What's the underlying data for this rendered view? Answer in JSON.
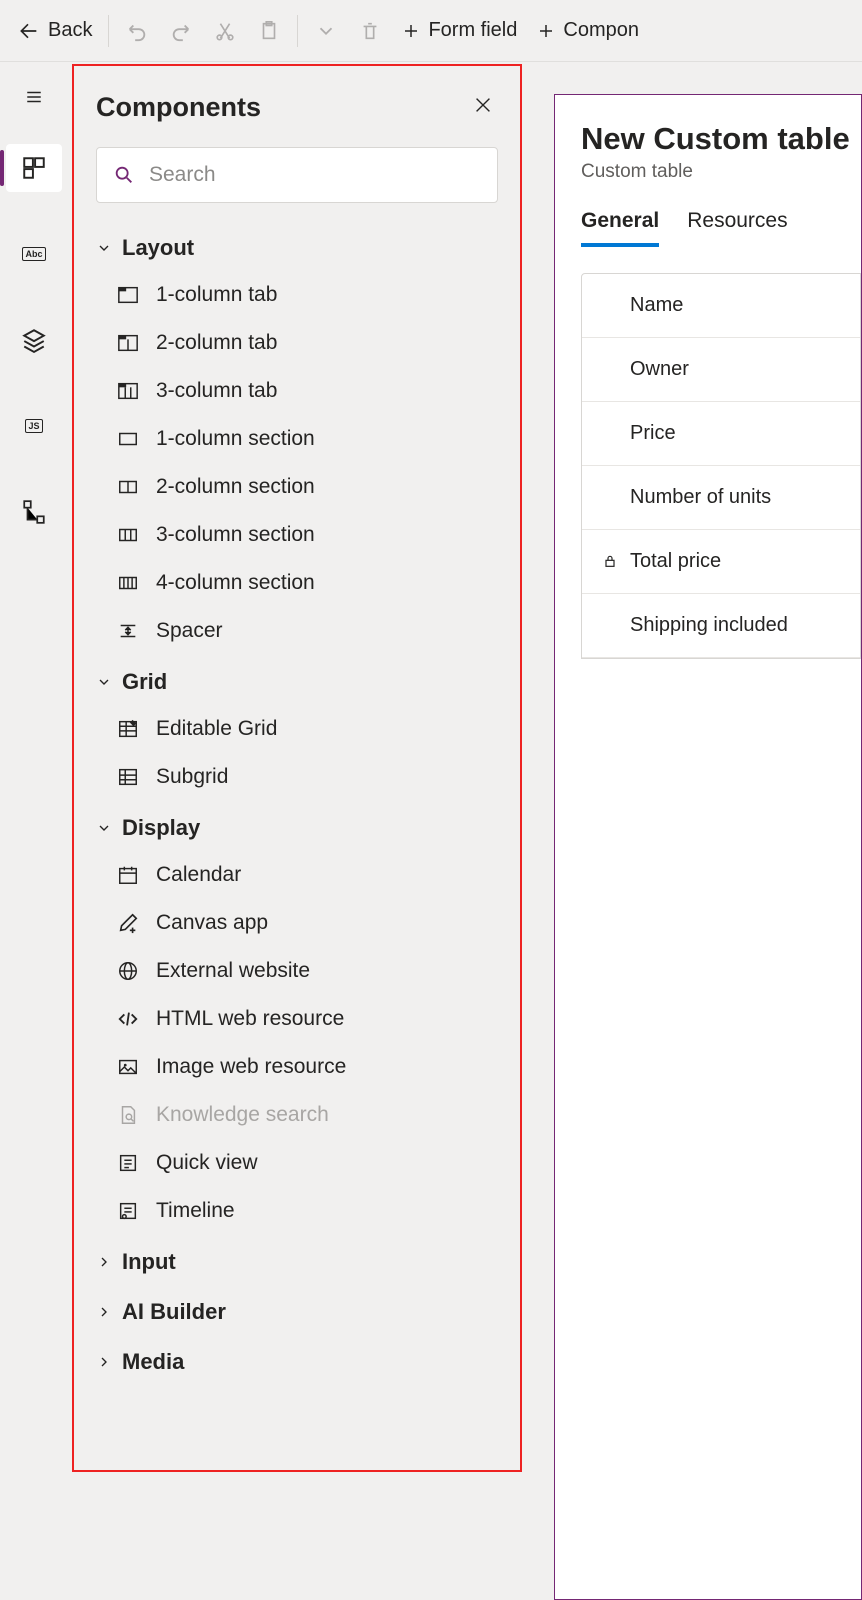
{
  "toolbar": {
    "back": "Back",
    "form_field": "Form field",
    "component": "Compon"
  },
  "panel": {
    "title": "Components",
    "search_placeholder": "Search",
    "groups": [
      {
        "label": "Layout",
        "expanded": true,
        "items": [
          {
            "label": "1-column tab",
            "icon": "tab1"
          },
          {
            "label": "2-column tab",
            "icon": "tab2"
          },
          {
            "label": "3-column tab",
            "icon": "tab3"
          },
          {
            "label": "1-column section",
            "icon": "sec1"
          },
          {
            "label": "2-column section",
            "icon": "sec2"
          },
          {
            "label": "3-column section",
            "icon": "sec3"
          },
          {
            "label": "4-column section",
            "icon": "sec4"
          },
          {
            "label": "Spacer",
            "icon": "spacer"
          }
        ]
      },
      {
        "label": "Grid",
        "expanded": true,
        "items": [
          {
            "label": "Editable Grid",
            "icon": "editgrid"
          },
          {
            "label": "Subgrid",
            "icon": "subgrid"
          }
        ]
      },
      {
        "label": "Display",
        "expanded": true,
        "items": [
          {
            "label": "Calendar",
            "icon": "calendar"
          },
          {
            "label": "Canvas app",
            "icon": "canvas"
          },
          {
            "label": "External website",
            "icon": "globe"
          },
          {
            "label": "HTML web resource",
            "icon": "html"
          },
          {
            "label": "Image web resource",
            "icon": "image"
          },
          {
            "label": "Knowledge search",
            "icon": "knowledge",
            "disabled": true
          },
          {
            "label": "Quick view",
            "icon": "quickview"
          },
          {
            "label": "Timeline",
            "icon": "timeline"
          }
        ]
      },
      {
        "label": "Input",
        "expanded": false
      },
      {
        "label": "AI Builder",
        "expanded": false
      },
      {
        "label": "Media",
        "expanded": false
      }
    ]
  },
  "preview": {
    "title": "New Custom table",
    "subtitle": "Custom table",
    "tabs": [
      {
        "label": "General",
        "active": true
      },
      {
        "label": "Resources"
      }
    ],
    "fields": [
      {
        "label": "Name"
      },
      {
        "label": "Owner"
      },
      {
        "label": "Price"
      },
      {
        "label": "Number of units"
      },
      {
        "label": "Total price",
        "locked": true
      },
      {
        "label": "Shipping included"
      }
    ]
  }
}
